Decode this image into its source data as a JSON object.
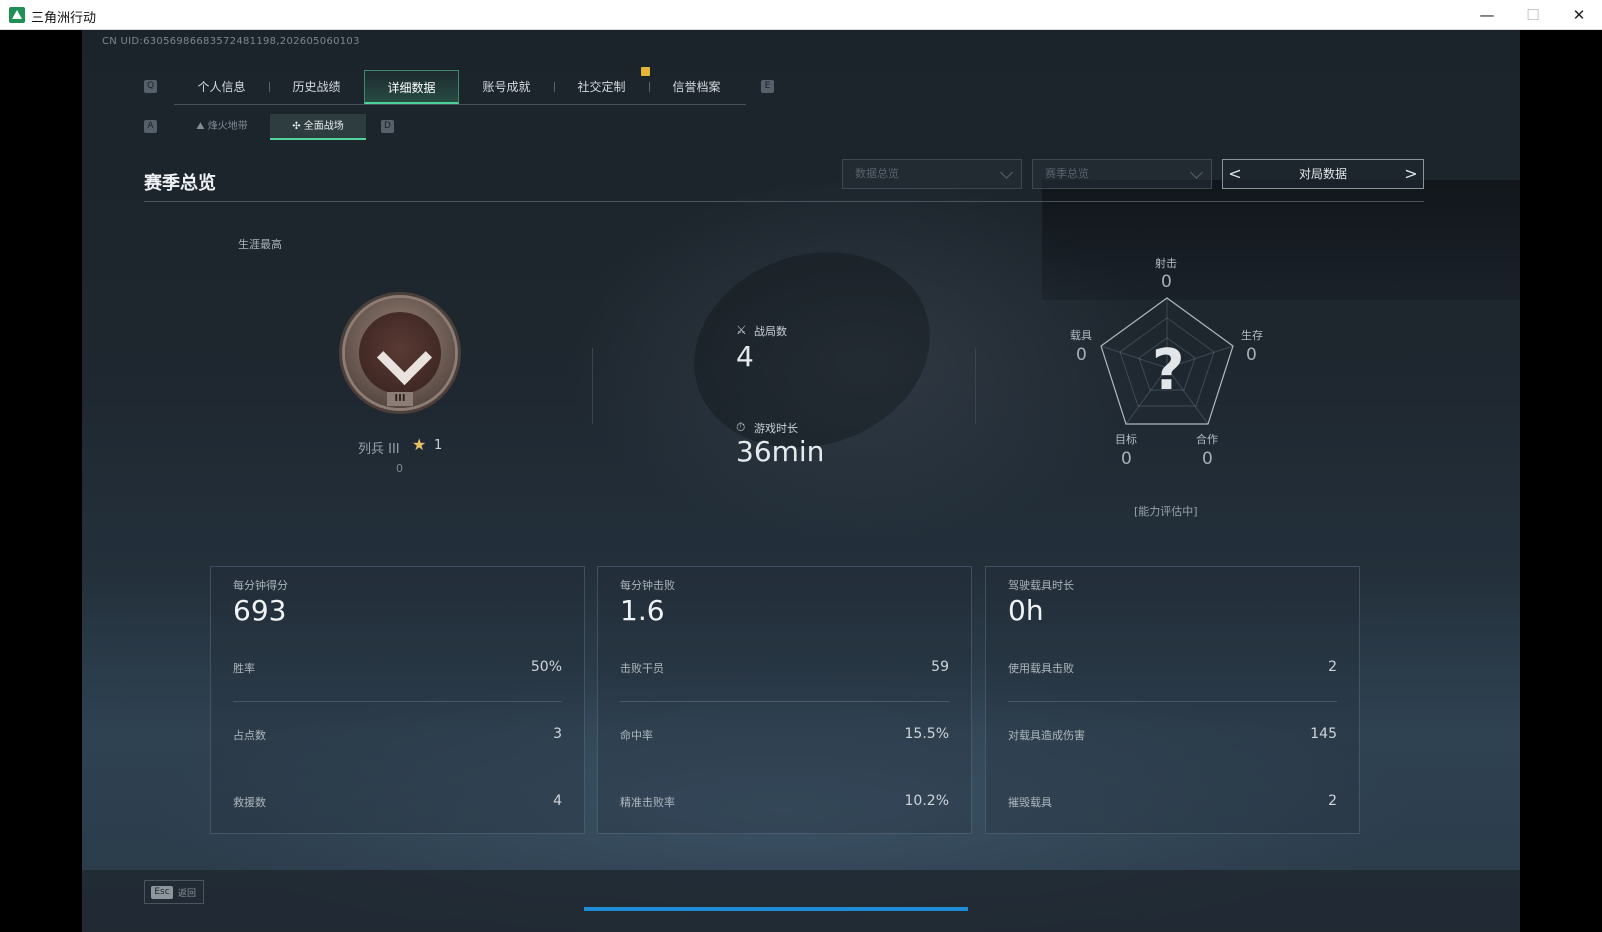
{
  "window": {
    "title": "三角洲行动",
    "minimize": "—",
    "maximize": "☐",
    "close": "✕"
  },
  "uid": "CN UID:630569866835724811​98,202605060103",
  "main_tabs": {
    "key_left": "Q",
    "key_right": "E",
    "items": [
      {
        "label": "个人信息"
      },
      {
        "label": "历史战绩"
      },
      {
        "label": "详细数据",
        "active": true
      },
      {
        "label": "账号成就"
      },
      {
        "label": "社交定制"
      },
      {
        "label": "信誉档案"
      }
    ]
  },
  "sub_tabs": {
    "key_left": "A",
    "key_right": "D",
    "items": [
      {
        "label": "烽火地带",
        "icon": "mountain-icon"
      },
      {
        "label": "全面战场",
        "icon": "crosshair-icon",
        "active": true
      }
    ]
  },
  "section": {
    "title": "赛季总览",
    "dropdown1": "数据总览",
    "dropdown2": "赛季总览",
    "pager_label": "对局数据",
    "pager_prev": "<",
    "pager_next": ">"
  },
  "career": {
    "label": "生涯最高",
    "rank_name": "列兵 III",
    "stars": "1",
    "score": "0",
    "medal_roman": "III"
  },
  "matches": {
    "label": "战局数",
    "value": "4",
    "icon": "crossed-swords-icon"
  },
  "playtime": {
    "label": "游戏时长",
    "value": "36min",
    "icon": "stopwatch-icon"
  },
  "radar": {
    "shooting": {
      "label": "射击",
      "value": "0"
    },
    "survival": {
      "label": "生存",
      "value": "0"
    },
    "vehicle": {
      "label": "载具",
      "value": "0"
    },
    "objective": {
      "label": "目标",
      "value": "0"
    },
    "teamwork": {
      "label": "合作",
      "value": "0"
    },
    "status": "[能力评估中]",
    "unknown_mark": "?"
  },
  "cards": [
    {
      "title": "每分钟得分",
      "value": "693",
      "rows": [
        {
          "label": "胜率",
          "value": "50%"
        },
        {
          "label": "占点数",
          "value": "3"
        },
        {
          "label": "救援数",
          "value": "4"
        }
      ]
    },
    {
      "title": "每分钟击败",
      "value": "1.6",
      "rows": [
        {
          "label": "击败干员",
          "value": "59"
        },
        {
          "label": "命中率",
          "value": "15.5%"
        },
        {
          "label": "精准击败率",
          "value": "10.2%"
        }
      ]
    },
    {
      "title": "驾驶载具时长",
      "value": "0h",
      "rows": [
        {
          "label": "使用载具击败",
          "value": "2"
        },
        {
          "label": "对载具造成伤害",
          "value": "145"
        },
        {
          "label": "摧毁载具",
          "value": "2"
        }
      ]
    }
  ],
  "footer": {
    "esc_key": "Esc",
    "esc_label": "返回"
  },
  "colors": {
    "accent": "#4fd39a",
    "badge": "#e8b33a",
    "progress": "#1f8ad6"
  }
}
